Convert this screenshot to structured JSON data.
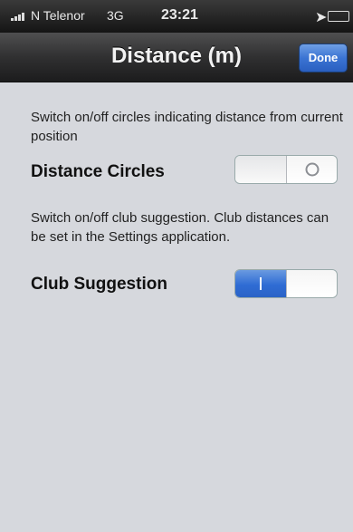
{
  "status_bar": {
    "carrier": "N Telenor",
    "network": "3G",
    "time": "23:21",
    "icons": [
      "signal-bars-icon",
      "location-arrow-icon",
      "battery-icon"
    ]
  },
  "nav": {
    "title": "Distance (m)",
    "done_label": "Done"
  },
  "settings": [
    {
      "description": "Switch on/off circles indicating distance from current position",
      "label": "Distance Circles",
      "state": "off"
    },
    {
      "description": "Switch on/off club suggestion. Club distances can be set in the Settings application.",
      "label": "Club Suggestion",
      "state": "on"
    }
  ],
  "colors": {
    "accent": "#2f6cd4",
    "background": "#d6d8dd",
    "navbar": "#303031"
  }
}
